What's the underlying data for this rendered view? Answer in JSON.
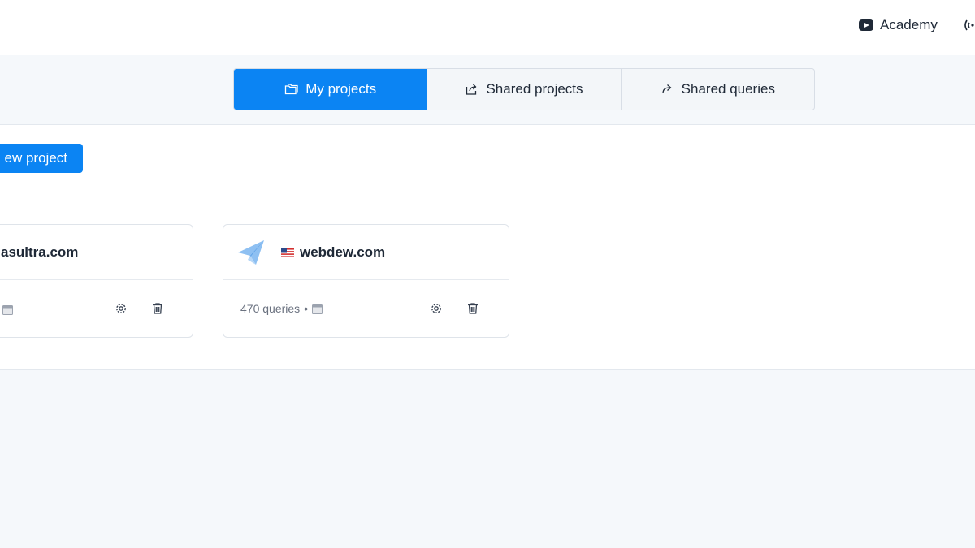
{
  "header": {
    "academy_label": "Academy",
    "academy_icon": "youtube-icon",
    "broadcast_icon": "broadcast-icon"
  },
  "tabs": [
    {
      "label": "My projects",
      "icon": "folders-icon",
      "active": true
    },
    {
      "label": "Shared projects",
      "icon": "share-icon",
      "active": false
    },
    {
      "label": "Shared queries",
      "icon": "forward-icon",
      "active": false
    }
  ],
  "actions": {
    "new_project_label": "ew project"
  },
  "projects": [
    {
      "title": "asultra.com",
      "queries": "",
      "icon": "paper-plane-icon"
    },
    {
      "title": "webdew.com",
      "flag": "us-flag-icon",
      "queries": "470 queries",
      "separator": "•",
      "icon": "paper-plane-icon"
    }
  ],
  "colors": {
    "accent": "#0b84f3",
    "page_bg": "#f5f8fb",
    "plane": "#7fb6ee"
  }
}
